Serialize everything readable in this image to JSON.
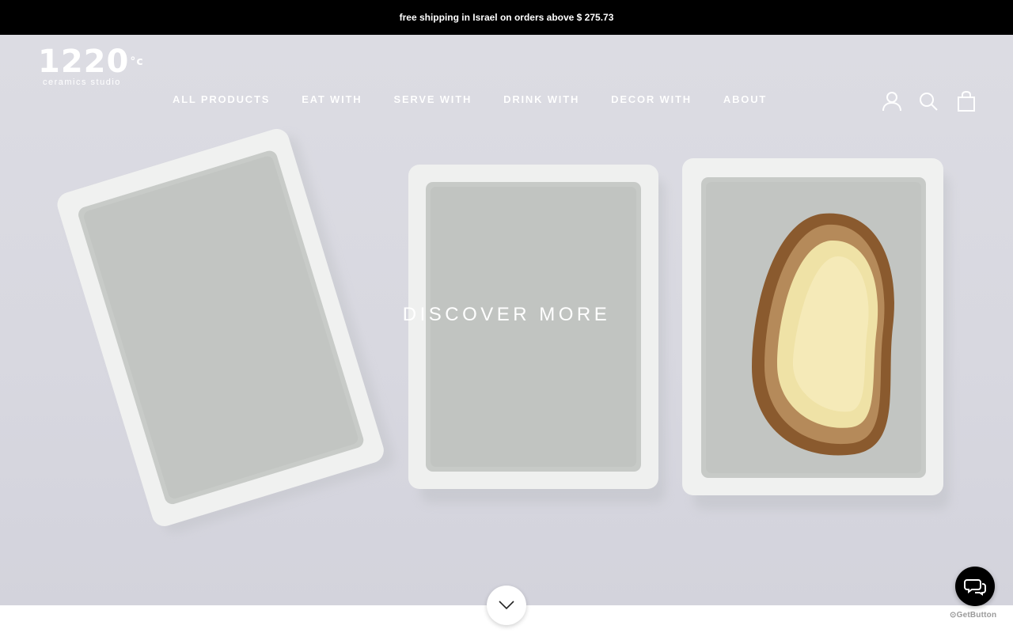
{
  "announcement": {
    "text": "free shipping in Israel on orders above $ 275.73"
  },
  "logo": {
    "main": "1220",
    "sup": "°c",
    "sub": "ceramics studio"
  },
  "nav": {
    "items": [
      {
        "label": "ALL PRODUCTS"
      },
      {
        "label": "EAT WITH"
      },
      {
        "label": "SERVE WITH"
      },
      {
        "label": "DRINK WITH"
      },
      {
        "label": "DECOR WITH"
      },
      {
        "label": "ABOUT"
      }
    ]
  },
  "header_icons": [
    "account-icon",
    "search-icon",
    "cart-icon"
  ],
  "hero": {
    "cta_label": "DISCOVER MORE"
  },
  "scroll": {
    "icon": "chevron-down-icon"
  },
  "chat_widget": {
    "icon": "chat-icon",
    "brand": "GetButton",
    "brand_color": "#000000"
  }
}
